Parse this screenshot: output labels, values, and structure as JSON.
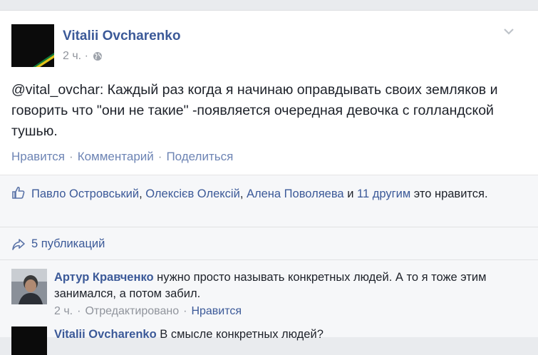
{
  "post": {
    "author": "Vitalii Ovcharenko",
    "time": "2 ч. ·",
    "text": "@vital_ovchar: Каждый раз когда я начинаю оправдывать своих земляков и говорить что \"они не такие\" -появляется очередная девочка с голландской тушью.",
    "actions": {
      "like": "Нравится",
      "comment": "Комментарий",
      "share": "Поделиться",
      "separator": "·"
    }
  },
  "likes": {
    "people": [
      "Павло Островський",
      "Олексієв Олексій",
      "Алена Поволяева"
    ],
    "comma": ",",
    "and": "и",
    "others": "11 другим",
    "suffix": "это нравится."
  },
  "shares": {
    "label": "5 публикаций"
  },
  "comments": [
    {
      "author": "Артур Кравченко",
      "text": "нужно просто называть конкретных людей. А то я тоже этим занимался, а потом забил.",
      "time": "2 ч.",
      "edited": "Отредактировано",
      "like": "Нравится",
      "separator": "·"
    },
    {
      "author": "Vitalii Ovcharenko",
      "text": "В смысле конкретных людей?"
    }
  ],
  "icons": {
    "chevron": "chevron-down-icon",
    "privacy": "globe-icon",
    "like": "thumbs-up-icon",
    "share": "share-arrow-icon"
  },
  "colors": {
    "link": "#3b5998",
    "text": "#1d2129",
    "muted": "#90949c",
    "panel": "#f6f7f9"
  }
}
